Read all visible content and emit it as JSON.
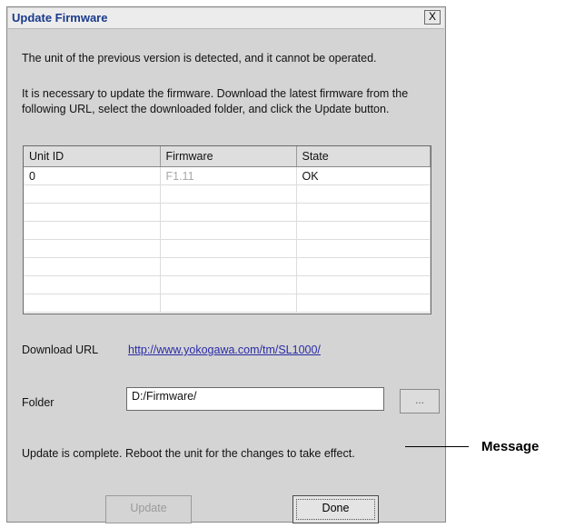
{
  "window": {
    "title": "Update Firmware",
    "close_label": "X"
  },
  "intro": {
    "line1": "The unit of the previous version is detected, and it cannot be operated.",
    "line2": "It is necessary to update the firmware. Download the latest firmware from the following URL, select the downloaded folder, and click the Update button."
  },
  "table": {
    "columns": [
      "Unit ID",
      "Firmware",
      "State"
    ],
    "rows": [
      [
        "0",
        "F1.11",
        "OK"
      ]
    ]
  },
  "download": {
    "label": "Download URL",
    "url": "http://www.yokogawa.com/tm/SL1000/"
  },
  "folder": {
    "label": "Folder",
    "value": "D:/Firmware/",
    "browse_label": "..."
  },
  "message": {
    "text": "Update is complete. Reboot the unit for the changes to take effect.",
    "callout": "Message"
  },
  "buttons": {
    "update": "Update",
    "done": "Done"
  }
}
